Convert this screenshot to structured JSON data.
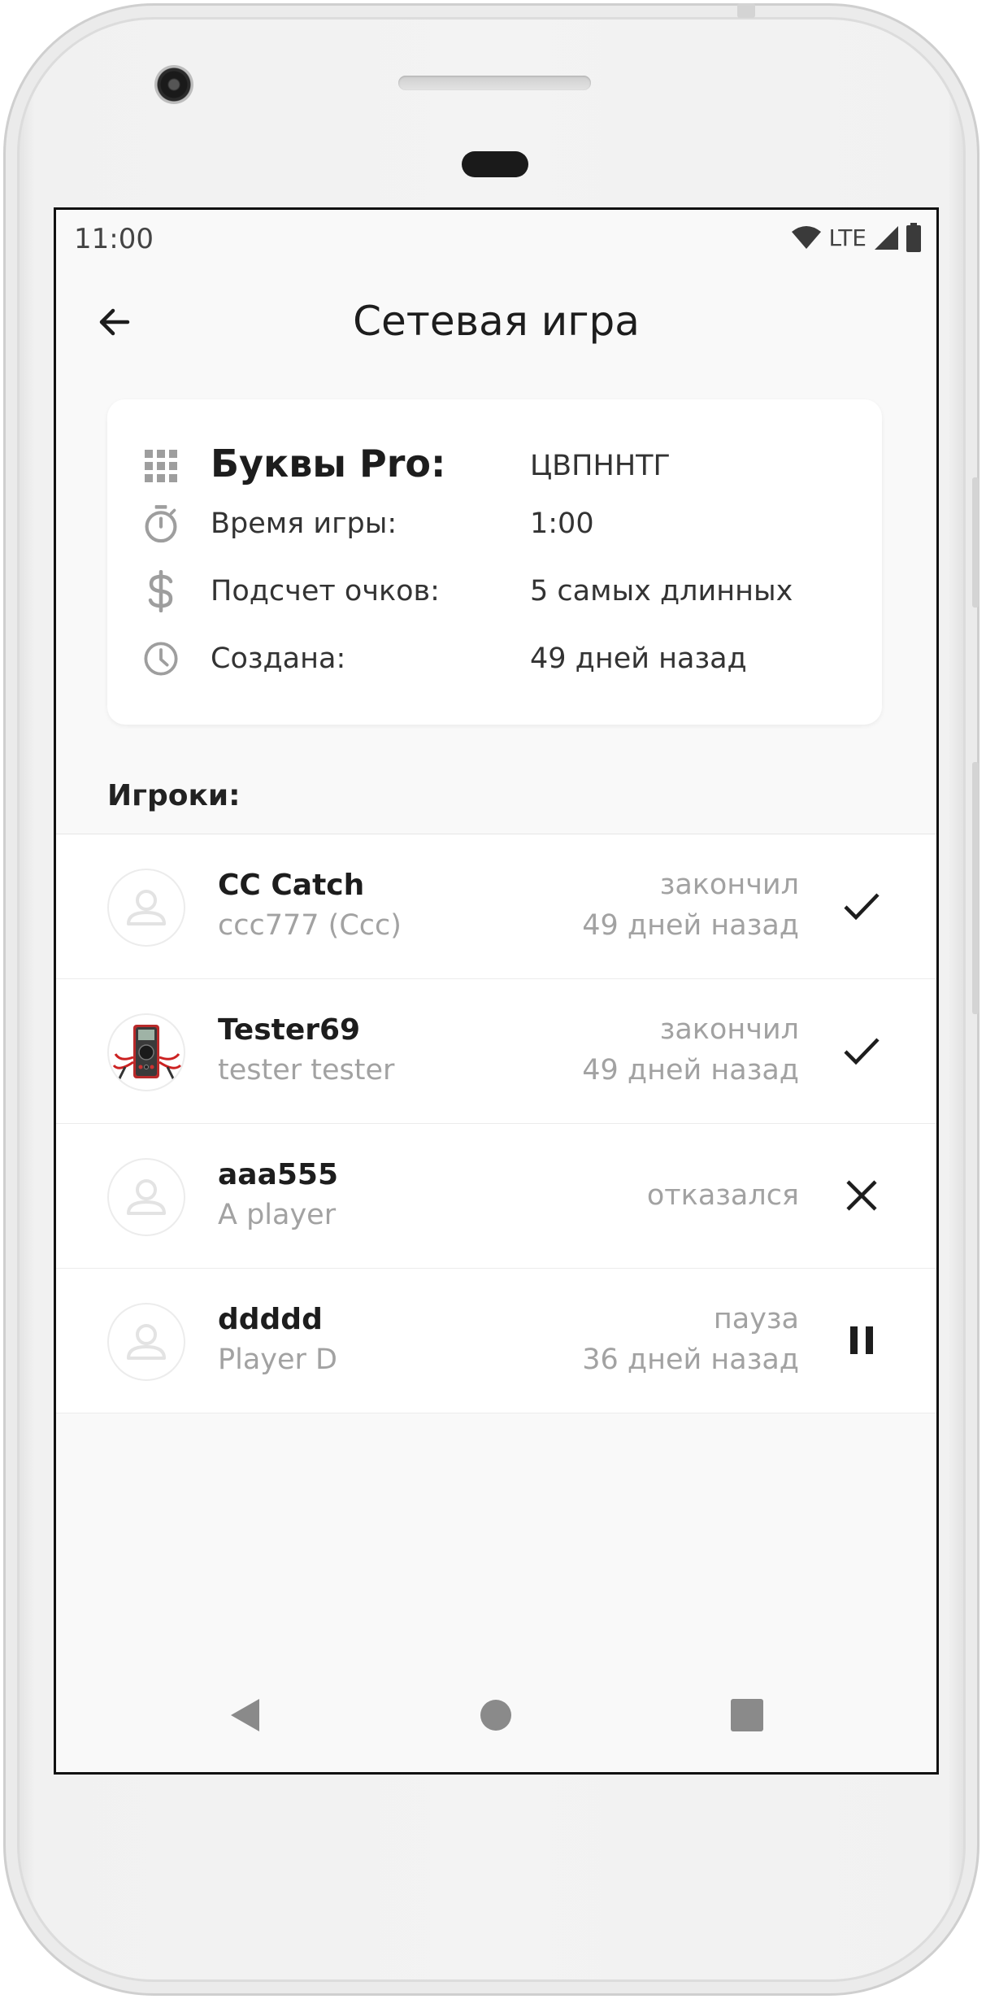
{
  "status_bar": {
    "time": "11:00",
    "network": "LTE",
    "icons": [
      "wifi-icon",
      "signal-icon",
      "battery-icon"
    ]
  },
  "header": {
    "title": "Сетевая игра",
    "back_icon": "arrow-left-icon"
  },
  "game_info": {
    "mode": {
      "icon": "grid-icon",
      "label": "Буквы Pro:",
      "value": "ЦВПННТГ"
    },
    "duration": {
      "icon": "stopwatch-icon",
      "label": "Время игры:",
      "value": "1:00"
    },
    "scoring": {
      "icon": "dollar-icon",
      "label": "Подсчет очков:",
      "value": "5 самых длинных"
    },
    "created": {
      "icon": "clock-icon",
      "label": "Создана:",
      "value": "49 дней назад"
    }
  },
  "players_label": "Игроки:",
  "players": [
    {
      "name": "CC Catch",
      "subtitle": "ccc777 (Ccc)",
      "status": "закончил",
      "time": "49 дней назад",
      "state_icon": "check-icon",
      "avatar": "default-avatar-icon"
    },
    {
      "name": "Tester69",
      "subtitle": "tester tester",
      "status": "закончил",
      "time": "49 дней назад",
      "state_icon": "check-icon",
      "avatar": "multimeter-photo"
    },
    {
      "name": "aaa555",
      "subtitle": "A player",
      "status": "отказался",
      "time": "",
      "state_icon": "close-icon",
      "avatar": "default-avatar-icon"
    },
    {
      "name": "ddddd",
      "subtitle": "Player D",
      "status": "пауза",
      "time": "36 дней назад",
      "state_icon": "pause-icon",
      "avatar": "default-avatar-icon"
    }
  ],
  "nav_bar": {
    "back": "nav-back-icon",
    "home": "nav-home-icon",
    "recents": "nav-recents-icon"
  },
  "colors": {
    "primary_text": "#1d1d1d",
    "secondary_text": "#a2a2a2",
    "icon_gray": "#9e9e9e",
    "background": "#f9f9f9",
    "card": "#ffffff"
  }
}
